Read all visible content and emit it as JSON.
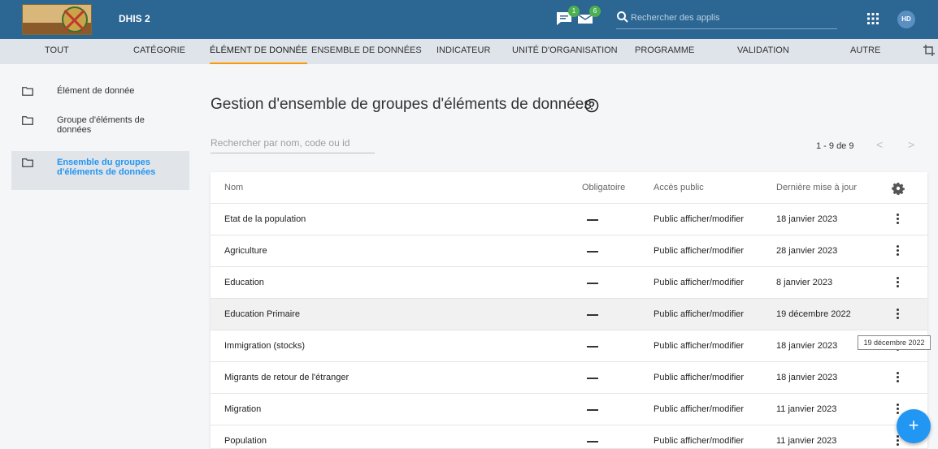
{
  "header": {
    "app_title": "DHIS 2",
    "messages_badge": "1",
    "interpretations_badge": "6",
    "search_placeholder": "Rechercher des applis",
    "avatar_initials": "HD",
    "bar_color": "#2c6693"
  },
  "tabs": [
    {
      "label": "TOUT"
    },
    {
      "label": "CATÉGORIE"
    },
    {
      "label": "ÉLÉMENT DE DONNÉE"
    },
    {
      "label": "ENSEMBLE DE DONNÉES"
    },
    {
      "label": "INDICATEUR"
    },
    {
      "label": "UNITÉ D'ORGANISATION"
    },
    {
      "label": "PROGRAMME"
    },
    {
      "label": "VALIDATION"
    },
    {
      "label": "AUTRE"
    }
  ],
  "active_tab": "ÉLÉMENT DE DONNÉE",
  "sidebar": {
    "items": [
      {
        "label": "Élément de donnée"
      },
      {
        "label": "Groupe d'éléments de données"
      },
      {
        "label": "Ensemble du groupes d'éléments de données"
      }
    ]
  },
  "main": {
    "title": "Gestion d'ensemble de groupes d'éléments de données",
    "search_placeholder": "Rechercher par nom, code ou id",
    "pager_text": "1 - 9 de 9",
    "pager_prev": "<",
    "pager_next": ">"
  },
  "table": {
    "headers": {
      "name": "Nom",
      "oblig": "Obligatoire",
      "access": "Accès public",
      "date": "Dernière mise à jour"
    },
    "rows": [
      {
        "name": "Etat de la population",
        "access": "Public afficher/modifier",
        "date": "18 janvier 2023"
      },
      {
        "name": "Agriculture",
        "access": "Public afficher/modifier",
        "date": "28 janvier 2023"
      },
      {
        "name": "Education",
        "access": "Public afficher/modifier",
        "date": "8 janvier 2023"
      },
      {
        "name": "Education Primaire",
        "access": "Public afficher/modifier",
        "date": "19 décembre 2022"
      },
      {
        "name": "Immigration (stocks)",
        "access": "Public afficher/modifier",
        "date": "18 janvier 2023"
      },
      {
        "name": "Migrants de retour de l'étranger",
        "access": "Public afficher/modifier",
        "date": "18 janvier 2023"
      },
      {
        "name": "Migration",
        "access": "Public afficher/modifier",
        "date": "11 janvier 2023"
      },
      {
        "name": "Population",
        "access": "Public afficher/modifier",
        "date": "11 janvier 2023"
      }
    ]
  },
  "tooltip": "19 décembre 2022",
  "fab_label": "+",
  "colors": {
    "accent": "#2196f3",
    "tab_indicator": "#ff9800",
    "badge": "#4caf50"
  }
}
